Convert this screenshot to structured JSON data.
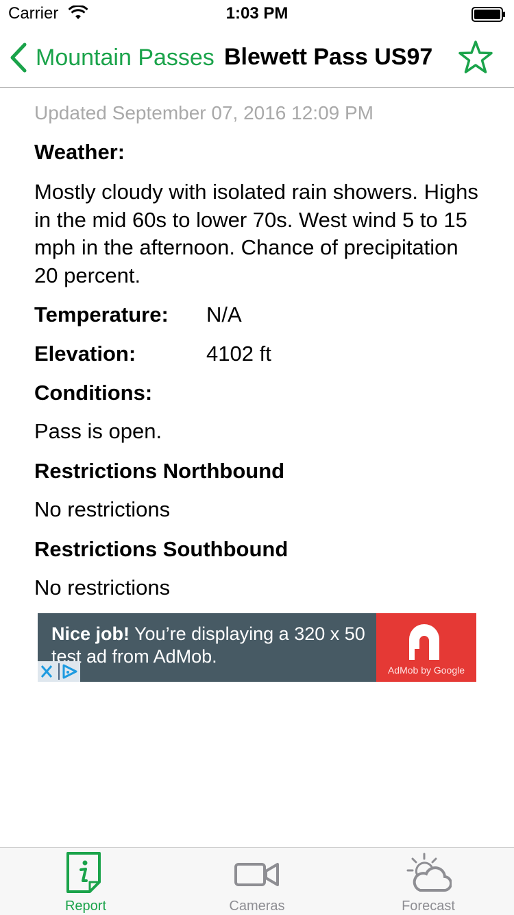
{
  "status_bar": {
    "carrier": "Carrier",
    "time": "1:03 PM"
  },
  "nav": {
    "back_label": "Mountain Passes",
    "title": "Blewett Pass US97"
  },
  "report": {
    "updated": "Updated September 07, 2016 12:09 PM",
    "weather_heading": "Weather:",
    "weather_text": "Mostly cloudy with isolated rain showers. Highs in the mid 60s to lower 70s. West wind 5 to 15 mph in the afternoon. Chance of precipitation 20 percent.",
    "temperature_label": "Temperature:",
    "temperature_value": "N/A",
    "elevation_label": "Elevation:",
    "elevation_value": "4102 ft",
    "conditions_heading": "Conditions:",
    "conditions_text": "Pass is open.",
    "restrictions_north_heading": "Restrictions Northbound",
    "restrictions_north_text": "No restrictions",
    "restrictions_south_heading": "Restrictions Southbound",
    "restrictions_south_text": "No restrictions"
  },
  "ad": {
    "bold_text": "Nice job!",
    "text": " You’re displaying a 320 x 50 test ad from AdMob.",
    "brand": "AdMob by Google"
  },
  "tabs": [
    {
      "label": "Report",
      "icon": "report-info-icon",
      "selected": true
    },
    {
      "label": "Cameras",
      "icon": "video-camera-icon",
      "selected": false
    },
    {
      "label": "Forecast",
      "icon": "partly-cloudy-icon",
      "selected": false
    }
  ],
  "colors": {
    "accent": "#1aa34a",
    "inactive_tab": "#8e8e93",
    "updated_text": "#a9a9a9",
    "ad_background": "#475a64",
    "ad_logo_background": "#e53935"
  }
}
